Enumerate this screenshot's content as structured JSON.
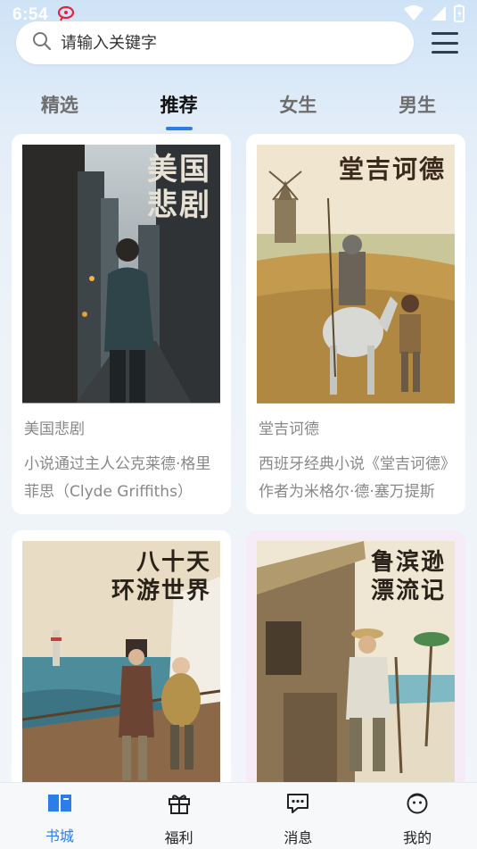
{
  "status_bar": {
    "time": "6:54"
  },
  "search": {
    "placeholder": "请输入关键字"
  },
  "tabs": [
    {
      "label": "精选",
      "active": false
    },
    {
      "label": "推荐",
      "active": true
    },
    {
      "label": "女生",
      "active": false
    },
    {
      "label": "男生",
      "active": false
    }
  ],
  "books": [
    {
      "cover_text_line1": "美国",
      "cover_text_line2": "悲剧",
      "title": "美国悲剧",
      "description": "小说通过主人公克莱德·格里菲思（Clyde Griffiths）"
    },
    {
      "cover_text_line1": "堂吉诃德",
      "title": "堂吉诃德",
      "description": "西班牙经典小说《堂吉诃德》作者为米格尔·德·塞万提斯"
    },
    {
      "cover_text_line1": "八十天",
      "cover_text_line2": "环游世界"
    },
    {
      "cover_text_line1": "鲁滨逊",
      "cover_text_line2": "漂流记"
    }
  ],
  "bottom_nav": [
    {
      "label": "书城",
      "icon": "book-icon",
      "active": true
    },
    {
      "label": "福利",
      "icon": "gift-icon",
      "active": false
    },
    {
      "label": "消息",
      "icon": "message-icon",
      "active": false
    },
    {
      "label": "我的",
      "icon": "profile-icon",
      "active": false
    }
  ],
  "colors": {
    "accent": "#2b7de9"
  }
}
